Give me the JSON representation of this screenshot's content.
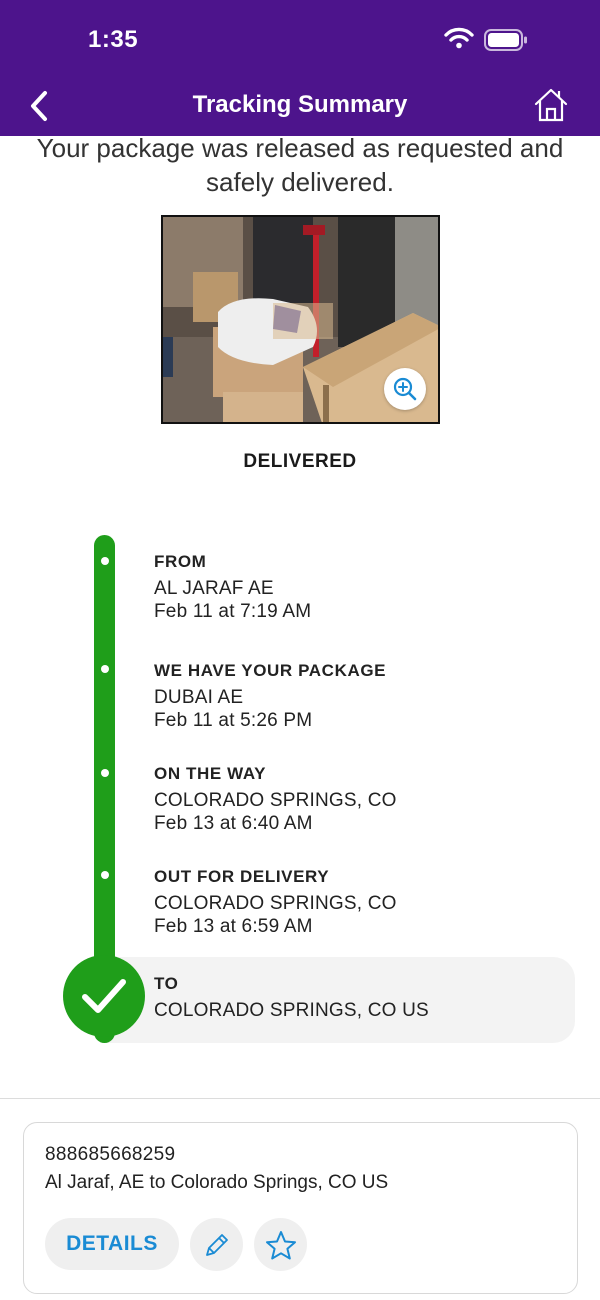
{
  "status_bar": {
    "time": "1:35",
    "wifi_icon": "wifi-icon",
    "battery_icon": "battery-icon"
  },
  "header": {
    "title": "Tracking Summary",
    "back_icon": "chevron-left-icon",
    "home_icon": "home-icon",
    "background": "#4d148c"
  },
  "message": "Your package was released as requested and safely delivered.",
  "photo": {
    "zoom_icon": "zoom-in-icon"
  },
  "status_label": "DELIVERED",
  "timeline": {
    "color": "#1f9e1a",
    "events": [
      {
        "title": "FROM",
        "location": "AL JARAF AE",
        "time": "Feb 11 at 7:19 AM"
      },
      {
        "title": "WE HAVE YOUR PACKAGE",
        "location": "DUBAI AE",
        "time": "Feb 11 at 5:26 PM"
      },
      {
        "title": "ON THE WAY",
        "location": "COLORADO SPRINGS, CO",
        "time": "Feb 13 at 6:40 AM"
      },
      {
        "title": "OUT FOR DELIVERY",
        "location": "COLORADO SPRINGS, CO",
        "time": "Feb 13 at 6:59 AM"
      }
    ],
    "destination": {
      "title": "TO",
      "location": "COLORADO SPRINGS, CO  US",
      "icon": "checkmark-icon"
    }
  },
  "shipment_card": {
    "tracking_number": "888685668259",
    "route": "Al Jaraf, AE to Colorado Springs, CO US",
    "details_label": "DETAILS",
    "edit_icon": "pencil-icon",
    "favorite_icon": "star-icon",
    "accent": "#1a8bd4"
  }
}
